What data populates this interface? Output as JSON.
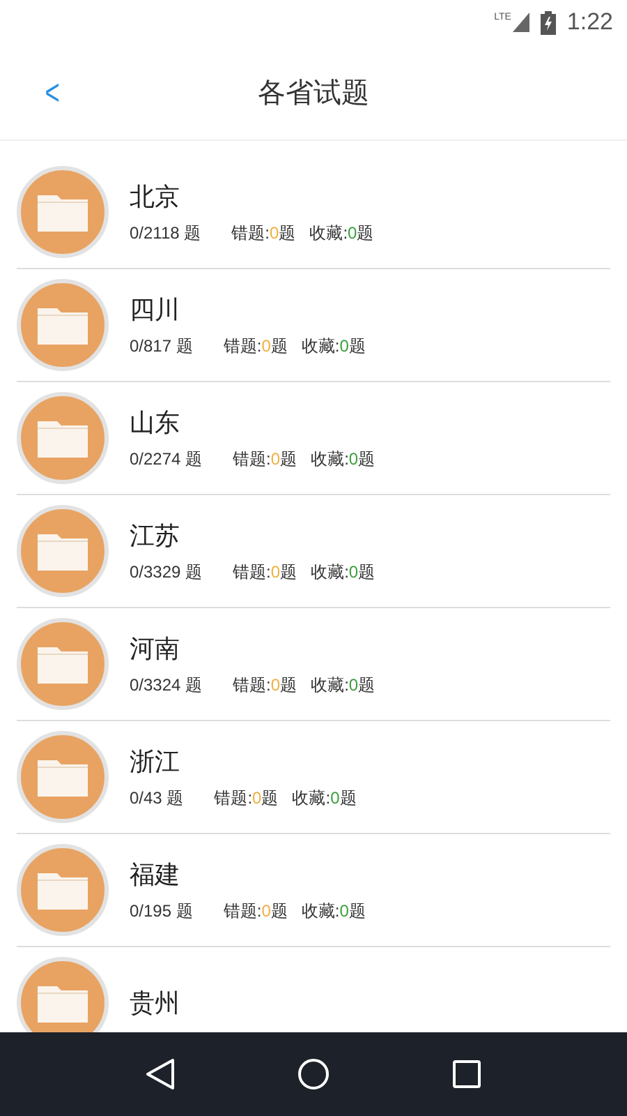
{
  "status_bar": {
    "network": "LTE",
    "time": "1:22"
  },
  "header": {
    "back": "<",
    "title": "各省试题"
  },
  "provinces": [
    {
      "name": "北京",
      "progress": "0/2118 题",
      "wrong_label": "错题:",
      "wrong": "0",
      "wrong_unit": "题",
      "fav_label": "收藏:",
      "fav": "0",
      "fav_unit": "题"
    },
    {
      "name": "四川",
      "progress": "0/817 题",
      "wrong_label": "错题:",
      "wrong": "0",
      "wrong_unit": "题",
      "fav_label": "收藏:",
      "fav": "0",
      "fav_unit": "题"
    },
    {
      "name": "山东",
      "progress": "0/2274 题",
      "wrong_label": "错题:",
      "wrong": "0",
      "wrong_unit": "题",
      "fav_label": "收藏:",
      "fav": "0",
      "fav_unit": "题"
    },
    {
      "name": "江苏",
      "progress": "0/3329 题",
      "wrong_label": "错题:",
      "wrong": "0",
      "wrong_unit": "题",
      "fav_label": "收藏:",
      "fav": "0",
      "fav_unit": "题"
    },
    {
      "name": "河南",
      "progress": "0/3324 题",
      "wrong_label": "错题:",
      "wrong": "0",
      "wrong_unit": "题",
      "fav_label": "收藏:",
      "fav": "0",
      "fav_unit": "题"
    },
    {
      "name": "浙江",
      "progress": "0/43 题",
      "wrong_label": "错题:",
      "wrong": "0",
      "wrong_unit": "题",
      "fav_label": "收藏:",
      "fav": "0",
      "fav_unit": "题"
    },
    {
      "name": "福建",
      "progress": "0/195 题",
      "wrong_label": "错题:",
      "wrong": "0",
      "wrong_unit": "题",
      "fav_label": "收藏:",
      "fav": "0",
      "fav_unit": "题"
    },
    {
      "name": "贵州"
    }
  ]
}
